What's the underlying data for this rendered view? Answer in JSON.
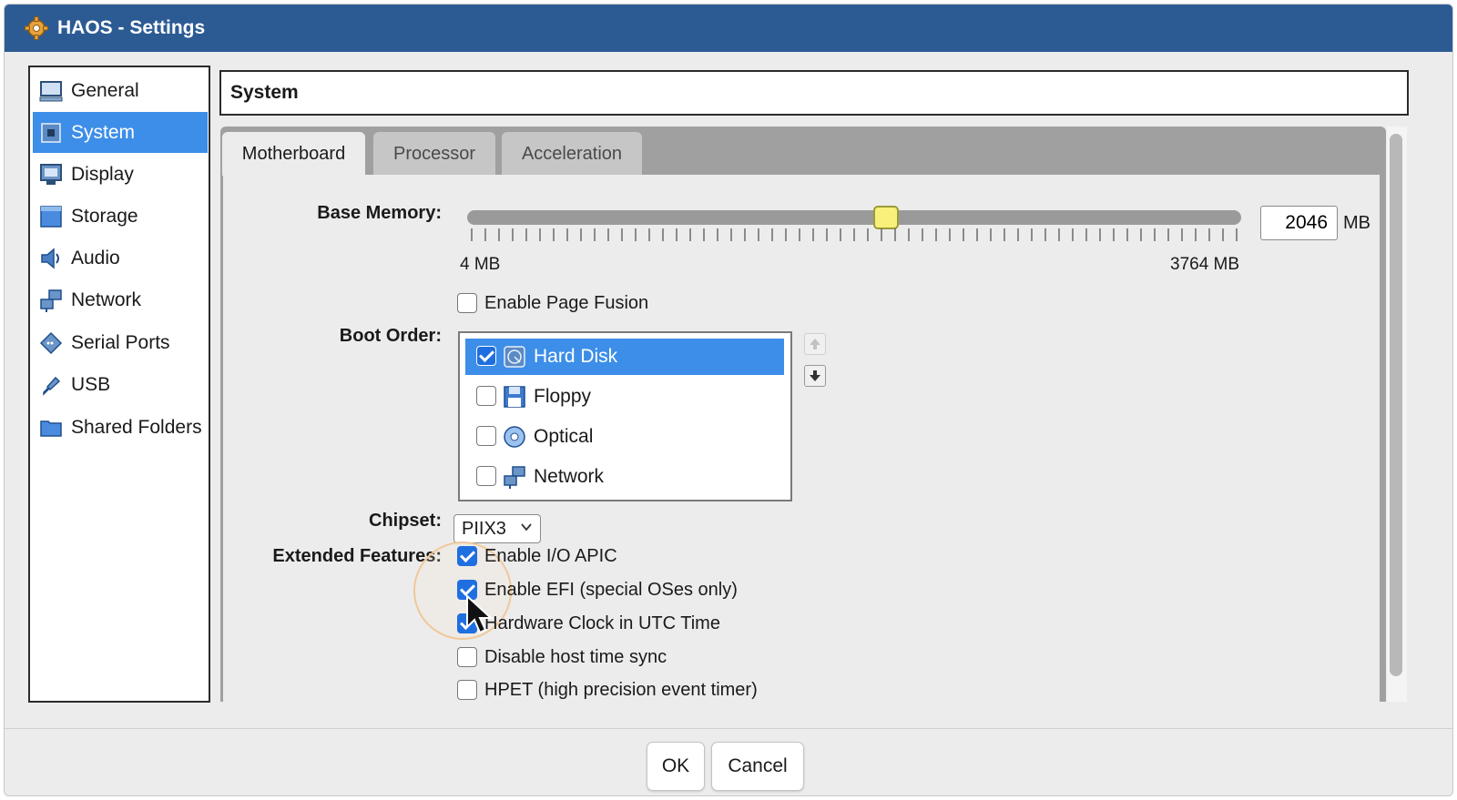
{
  "window": {
    "title": "HAOS - Settings"
  },
  "sidebar": {
    "items": [
      {
        "label": "General",
        "icon": "monitor-icon"
      },
      {
        "label": "System",
        "icon": "chip-icon",
        "selected": true
      },
      {
        "label": "Display",
        "icon": "display-icon"
      },
      {
        "label": "Storage",
        "icon": "storage-icon"
      },
      {
        "label": "Audio",
        "icon": "speaker-icon"
      },
      {
        "label": "Network",
        "icon": "network-icon"
      },
      {
        "label": "Serial Ports",
        "icon": "serial-port-icon"
      },
      {
        "label": "USB",
        "icon": "usb-icon"
      },
      {
        "label": "Shared Folders",
        "icon": "folder-icon"
      }
    ]
  },
  "header": {
    "title": "System"
  },
  "tabs": [
    {
      "label": "Motherboard",
      "active": true
    },
    {
      "label": "Processor",
      "active": false
    },
    {
      "label": "Acceleration",
      "active": false
    }
  ],
  "motherboard": {
    "base_memory": {
      "label": "Base Memory:",
      "value": "2046",
      "unit": "MB",
      "min_label": "4 MB",
      "max_label": "3764 MB",
      "slider_fraction": 0.543
    },
    "page_fusion": {
      "label": "Enable Page Fusion",
      "checked": false
    },
    "boot_order": {
      "label": "Boot Order:",
      "items": [
        {
          "label": "Hard Disk",
          "checked": true,
          "selected": true,
          "icon": "hard-disk-icon"
        },
        {
          "label": "Floppy",
          "checked": false,
          "selected": false,
          "icon": "floppy-icon"
        },
        {
          "label": "Optical",
          "checked": false,
          "selected": false,
          "icon": "optical-disc-icon"
        },
        {
          "label": "Network",
          "checked": false,
          "selected": false,
          "icon": "network-icon"
        }
      ],
      "up_icon": "arrow-up-icon",
      "down_icon": "arrow-down-icon"
    },
    "chipset": {
      "label": "Chipset:",
      "value": "PIIX3"
    },
    "extended_features": {
      "label": "Extended Features:",
      "items": [
        {
          "label": "Enable I/O APIC",
          "checked": true
        },
        {
          "label": "Enable EFI (special OSes only)",
          "checked": true
        },
        {
          "label": "Hardware Clock in UTC Time",
          "checked": true
        },
        {
          "label": "Disable host time sync",
          "checked": false
        },
        {
          "label": "HPET (high precision event timer)",
          "checked": false
        }
      ]
    }
  },
  "buttons": {
    "ok": "OK",
    "cancel": "Cancel"
  },
  "colors": {
    "titlebar": "#2c5b94",
    "selection": "#3d8ee8",
    "checkbox": "#1f6fe0",
    "slider_thumb": "#f7f07a"
  }
}
